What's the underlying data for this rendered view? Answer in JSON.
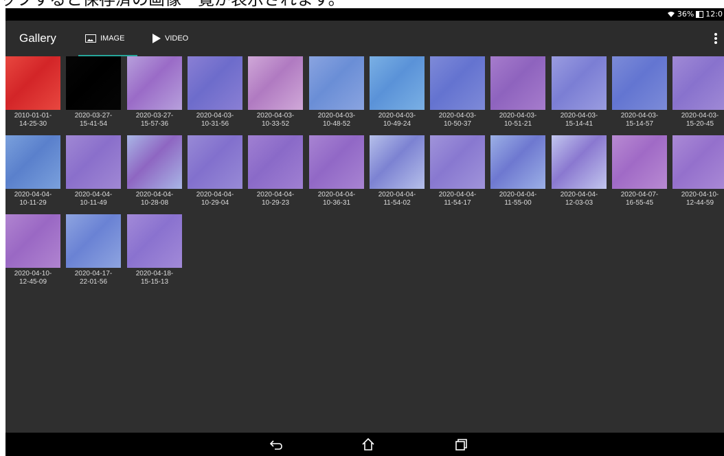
{
  "caption": "ップすると保存済の画像一覧が表示されます。",
  "status": {
    "battery_text": "36%",
    "time": "12:0"
  },
  "appbar": {
    "title": "Gallery",
    "tabs": [
      {
        "label": "IMAGE",
        "icon": "image-icon",
        "selected": true
      },
      {
        "label": "VIDEO",
        "icon": "play-icon",
        "selected": false
      }
    ],
    "overflow_icon": "more-vert-icon"
  },
  "colors": {
    "accent": "#26a69a",
    "background": "#2f2f2f",
    "appbar": "#2c2c2c"
  },
  "images": [
    {
      "label": "2010-01-01-\n14-25-30",
      "color": "#d32528",
      "color2": "#e8473f"
    },
    {
      "label": "2020-03-27-\n15-41-54",
      "color": "#000000",
      "color2": "#050505"
    },
    {
      "label": "2020-03-27-\n15-57-36",
      "color": "#9a6bc7",
      "color2": "#b7a0dc"
    },
    {
      "label": "2020-04-03-\n10-31-56",
      "color": "#6d6ccb",
      "color2": "#8a7fd4"
    },
    {
      "label": "2020-04-03-\n10-33-52",
      "color": "#b07ac1",
      "color2": "#d0a8d8"
    },
    {
      "label": "2020-04-03-\n10-48-52",
      "color": "#6a8ed6",
      "color2": "#8aa4e0"
    },
    {
      "label": "2020-04-03-\n10-49-24",
      "color": "#5a92d8",
      "color2": "#7ab0e4"
    },
    {
      "label": "2020-04-03-\n10-50-37",
      "color": "#6473d0",
      "color2": "#7e8ad8"
    },
    {
      "label": "2020-04-03-\n10-51-21",
      "color": "#8e63be",
      "color2": "#a67ccc"
    },
    {
      "label": "2020-04-03-\n15-14-41",
      "color": "#7b7ed4",
      "color2": "#9a9ce0"
    },
    {
      "label": "2020-04-03-\n15-14-57",
      "color": "#6375d1",
      "color2": "#7c8bd8"
    },
    {
      "label": "2020-04-03-\n15-20-45",
      "color": "#8872cd",
      "color2": "#a08ad6"
    },
    {
      "label": "2020-04-04-\n10-11-29",
      "color": "#5a80cc",
      "color2": "#7aa0dc"
    },
    {
      "label": "2020-04-04-\n10-11-49",
      "color": "#8a6fcb",
      "color2": "#a088d4"
    },
    {
      "label": "2020-04-04-\n10-28-08",
      "color": "#8e66c2",
      "color2": "#a9b6e6"
    },
    {
      "label": "2020-04-04-\n10-29-04",
      "color": "#8270cd",
      "color2": "#988ad6"
    },
    {
      "label": "2020-04-04-\n10-29-23",
      "color": "#8a6ac8",
      "color2": "#a080d2"
    },
    {
      "label": "2020-04-04-\n10-36-31",
      "color": "#9168c6",
      "color2": "#a884d2"
    },
    {
      "label": "2020-04-04-\n11-54-02",
      "color": "#7c82d2",
      "color2": "#b6c0ea"
    },
    {
      "label": "2020-04-04-\n11-54-17",
      "color": "#8878d0",
      "color2": "#a094da"
    },
    {
      "label": "2020-04-04-\n11-55-00",
      "color": "#6e78d0",
      "color2": "#9cb0e6"
    },
    {
      "label": "2020-04-04-\n12-03-03",
      "color": "#8a78d0",
      "color2": "#c2c6ee"
    },
    {
      "label": "2020-04-07-\n16-55-45",
      "color": "#a06ac6",
      "color2": "#b88ad2"
    },
    {
      "label": "2020-04-10-\n12-44-59",
      "color": "#9470cc",
      "color2": "#aa8ad6"
    },
    {
      "label": "2020-04-10-\n12-45-09",
      "color": "#9a68c4",
      "color2": "#b084d0"
    },
    {
      "label": "2020-04-17-\n22-01-56",
      "color": "#6a82d4",
      "color2": "#8ea4e0"
    },
    {
      "label": "2020-04-18-\n15-15-13",
      "color": "#8a72cf",
      "color2": "#a28ad8"
    }
  ],
  "navbar": {
    "back_icon": "back-icon",
    "home_icon": "home-icon",
    "recents_icon": "recents-icon"
  }
}
